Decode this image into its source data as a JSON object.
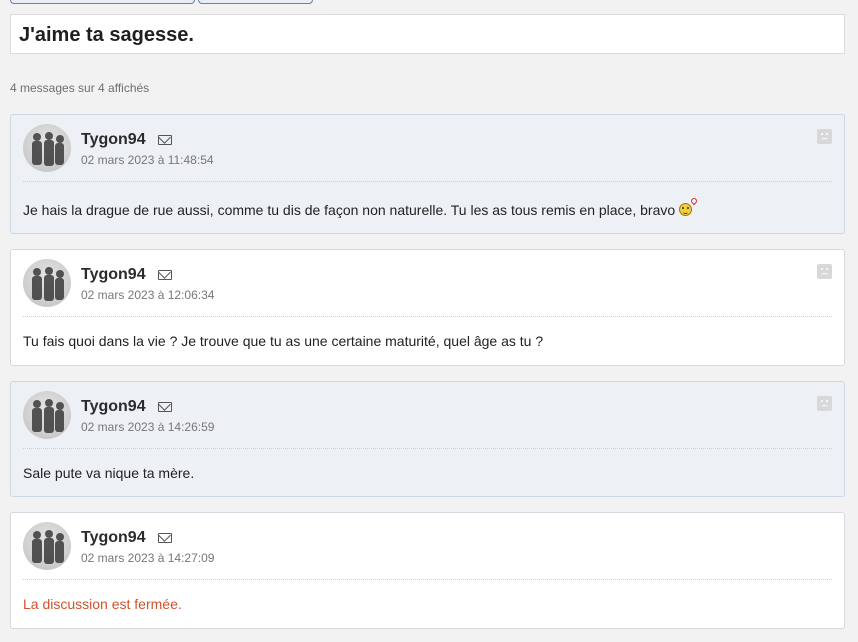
{
  "thread_title": "J'aime ta sagesse.",
  "message_count": "4 messages sur 4 affichés",
  "messages": [
    {
      "author": "Tygon94",
      "date": "02 mars 2023 à 11:48:54",
      "text": "Je hais la drague de rue aussi, comme tu dis de façon non naturelle. Tu les as tous remis en place, bravo",
      "emoji": "in-love-smiley-icon"
    },
    {
      "author": "Tygon94",
      "date": "02 mars 2023 à 12:06:34",
      "text": "Tu fais quoi dans la vie ? Je trouve que tu as une certaine maturité, quel âge as tu ?"
    },
    {
      "author": "Tygon94",
      "date": "02 mars 2023 à 14:26:59",
      "text": "Sale pute va nique ta mère."
    },
    {
      "author": "Tygon94",
      "date": "02 mars 2023 à 14:27:09",
      "text": "La discussion est fermée."
    }
  ],
  "colors": {
    "alt_message_bg": "#edf0f5",
    "closed_text": "#d1522a"
  }
}
